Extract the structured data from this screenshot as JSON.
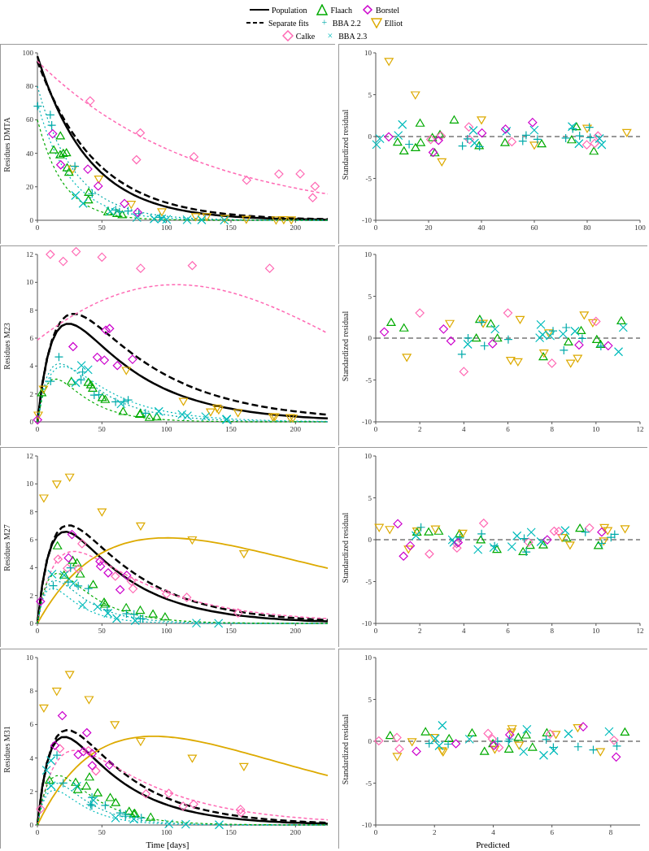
{
  "legend": {
    "row1": [
      {
        "label": "Population",
        "type": "line",
        "color": "#000000",
        "dash": "solid"
      },
      {
        "label": "Flaach",
        "type": "symbol",
        "color": "#00aa00",
        "symbol": "△"
      },
      {
        "label": "Borstel",
        "type": "symbol",
        "color": "#cc00cc",
        "symbol": "⬦"
      }
    ],
    "row2": [
      {
        "label": "Separate fits",
        "type": "line",
        "color": "#000000",
        "dash": "dashed"
      },
      {
        "label": "BBA 2.2",
        "type": "symbol",
        "color": "#00cccc",
        "symbol": "+"
      },
      {
        "label": "Elliot",
        "type": "symbol",
        "color": "#ddaa00",
        "symbol": "▽"
      }
    ],
    "row3": [
      {
        "label": "Calke",
        "type": "symbol",
        "color": "#ff69b4",
        "symbol": "◇"
      },
      {
        "label": "BBA 2.3",
        "type": "symbol",
        "color": "#00aaaa",
        "symbol": "×"
      }
    ]
  },
  "rows": [
    {
      "left_ylabel": "Residues DMTA",
      "right_ylabel": "Standardized residual",
      "left_xmax": 225,
      "left_ymax": 100,
      "right_xmax": 100,
      "right_ymin": -10,
      "right_ymax": 10
    },
    {
      "left_ylabel": "Residues M23",
      "right_ylabel": "Standardized residual",
      "left_xmax": 225,
      "left_ymax": 12,
      "right_xmax": 12,
      "right_ymin": -10,
      "right_ymax": 10
    },
    {
      "left_ylabel": "Residues M27",
      "right_ylabel": "Standardized residual",
      "left_xmax": 225,
      "left_ymax": 12,
      "right_xmax": 12,
      "right_ymin": -10,
      "right_ymax": 10
    },
    {
      "left_ylabel": "Residues M31",
      "right_ylabel": "Standardized residual",
      "left_xmax": 225,
      "left_ymax": 10,
      "right_xmax": 9,
      "right_ymin": -10,
      "right_ymax": 10
    }
  ],
  "bottom_labels": {
    "left": "Time [days]",
    "right": "Predicted"
  }
}
